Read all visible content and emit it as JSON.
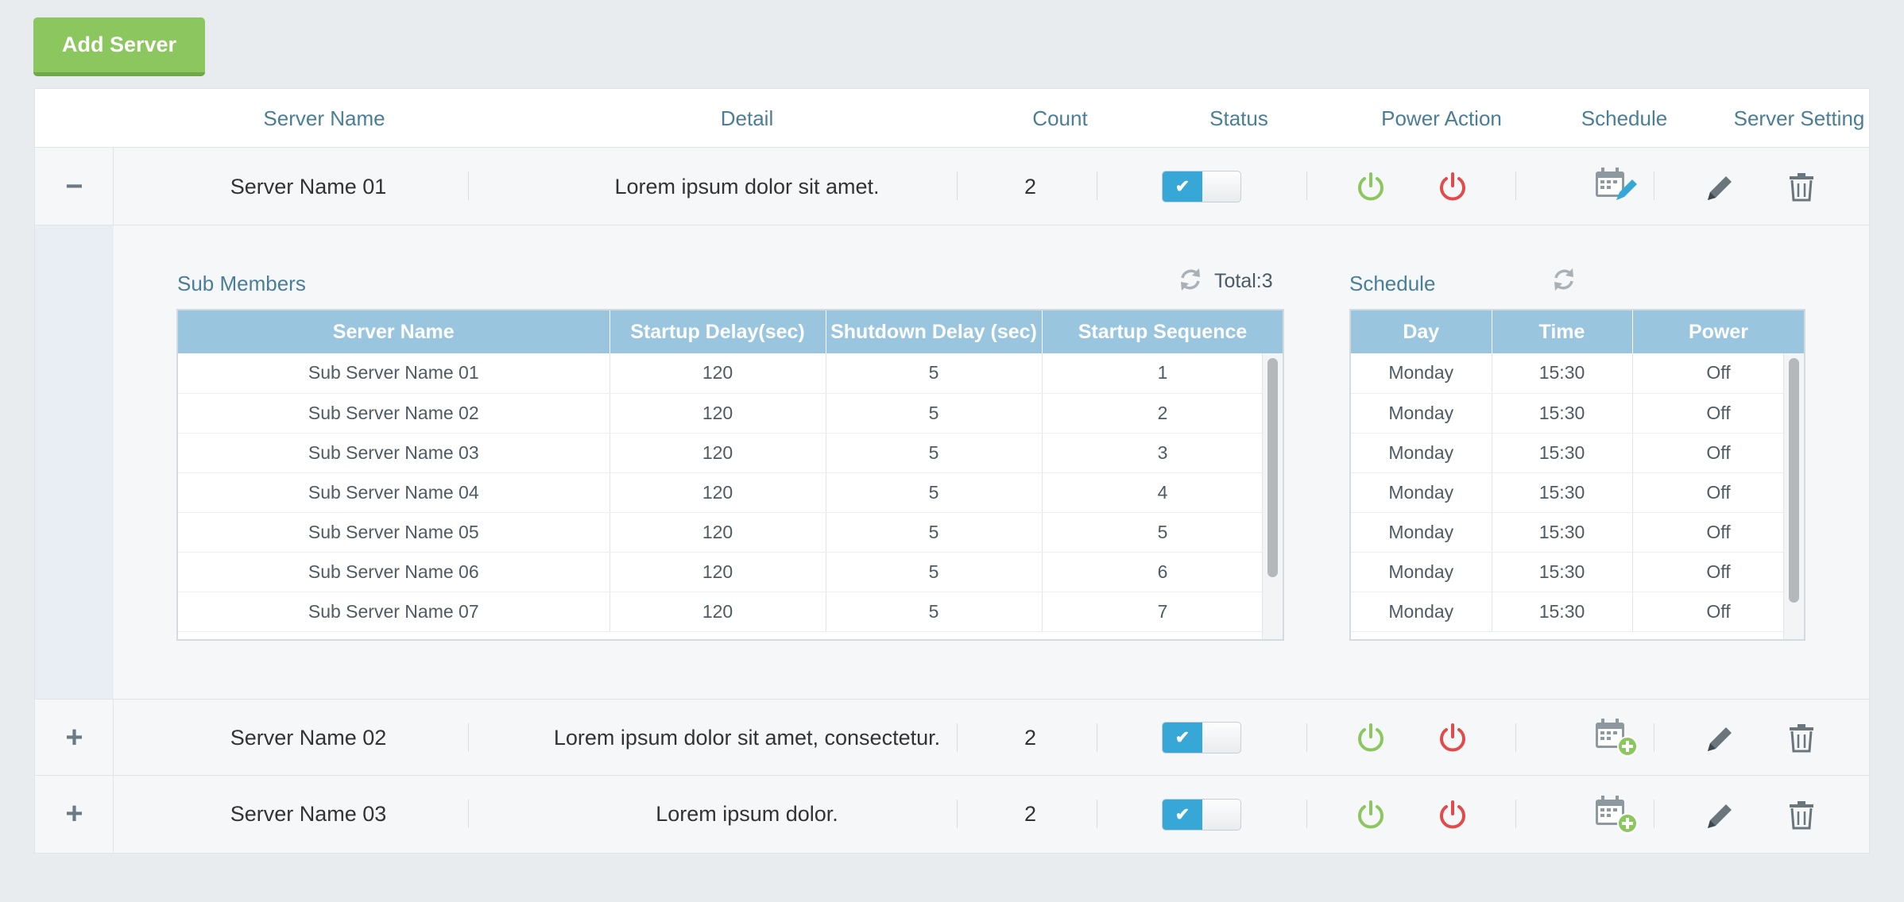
{
  "add_button": "Add Server",
  "header": {
    "server_name": "Server Name",
    "detail": "Detail",
    "count": "Count",
    "status": "Status",
    "power_action": "Power Action",
    "schedule": "Schedule",
    "server_setting": "Server Setting"
  },
  "servers": [
    {
      "toggle": "−",
      "name": "Server Name 01",
      "detail": "Lorem ipsum dolor sit amet.",
      "count": "2",
      "status_on": true,
      "schedule_icon": "calendar-edit-icon"
    },
    {
      "toggle": "+",
      "name": "Server Name 02",
      "detail": "Lorem ipsum dolor sit amet, consectetur.",
      "count": "2",
      "status_on": true,
      "schedule_icon": "calendar-add-icon"
    },
    {
      "toggle": "+",
      "name": "Server Name 03",
      "detail": "Lorem ipsum dolor.",
      "count": "2",
      "status_on": true,
      "schedule_icon": "calendar-add-icon"
    }
  ],
  "sub_members": {
    "title": "Sub Members",
    "total": "Total:3",
    "columns": [
      "Server Name",
      "Startup Delay(sec)",
      "Shutdown Delay (sec)",
      "Startup Sequence"
    ],
    "rows": [
      [
        "Sub Server Name 01",
        "120",
        "5",
        "1"
      ],
      [
        "Sub Server Name 02",
        "120",
        "5",
        "2"
      ],
      [
        "Sub Server Name 03",
        "120",
        "5",
        "3"
      ],
      [
        "Sub Server Name 04",
        "120",
        "5",
        "4"
      ],
      [
        "Sub Server Name 05",
        "120",
        "5",
        "5"
      ],
      [
        "Sub Server Name 06",
        "120",
        "5",
        "6"
      ],
      [
        "Sub Server Name 07",
        "120",
        "5",
        "7"
      ]
    ]
  },
  "schedule": {
    "title": "Schedule",
    "columns": [
      "Day",
      "Time",
      "Power"
    ],
    "rows": [
      [
        "Monday",
        "15:30",
        "Off"
      ],
      [
        "Monday",
        "15:30",
        "Off"
      ],
      [
        "Monday",
        "15:30",
        "Off"
      ],
      [
        "Monday",
        "15:30",
        "Off"
      ],
      [
        "Monday",
        "15:30",
        "Off"
      ],
      [
        "Monday",
        "15:30",
        "Off"
      ],
      [
        "Monday",
        "15:30",
        "Off"
      ]
    ]
  },
  "colors": {
    "accent": "#37a7d7",
    "power_on": "#8cc65e",
    "power_off": "#e04b4b",
    "header_text": "#4a7d96",
    "table_header": "#99c6de",
    "add_button": "#8cc65e"
  }
}
